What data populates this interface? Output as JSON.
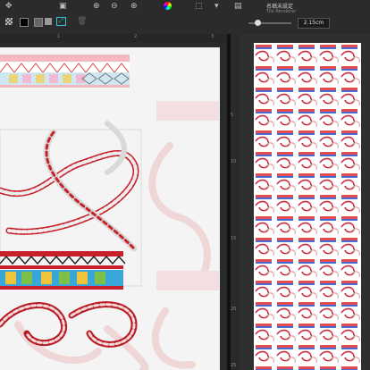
{
  "toolbar": {
    "icons": [
      "pointer-icon",
      "image-icon",
      "zoom-in-icon",
      "zoom-out-icon",
      "zoom-in-icon-2",
      "zoom-out-icon-2",
      "color-wheel-icon",
      "frame-icon"
    ],
    "sub_icons": [
      "checker-icon",
      "swatch-black-icon",
      "swatch-dark-icon",
      "fit-icon",
      "trash-icon"
    ]
  },
  "left_ruler": {
    "ticks": [
      "1",
      "2",
      "3"
    ]
  },
  "right_header": {
    "doc_title": "名稱未設定",
    "doc_subtitle": "Tile Renderer",
    "size_value": "2.15cm"
  },
  "vertical_ruler": {
    "ticks": [
      "5",
      "10",
      "15",
      "20",
      "25"
    ]
  },
  "colors": {
    "accent": "#31c5d6",
    "rope_red": "#c8202a",
    "rope_pink": "#e8a0a4",
    "band_pink": "#f2b7bf"
  }
}
